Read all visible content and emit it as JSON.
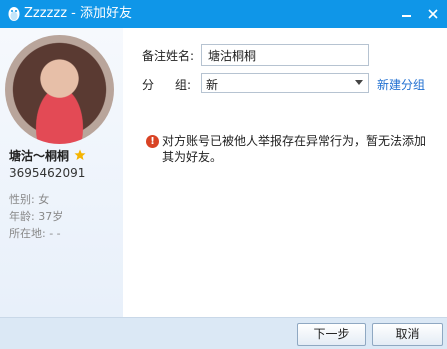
{
  "window": {
    "title": "Zzzzzz - 添加好友"
  },
  "profile": {
    "nickname": "塘沽～桐桐",
    "qq": "3695462091",
    "gender": "性别: 女",
    "age": "年龄: 37岁",
    "location": "所在地:  -    -"
  },
  "form": {
    "remark_label": "备注姓名:",
    "remark_value": "塘沽桐桐",
    "group_label_1": "分",
    "group_label_2": "组:",
    "group_value": "新",
    "new_group_link": "新建分组"
  },
  "warning": {
    "text": "对方账号已被他人举报存在异常行为，暂无法添加其为好友。"
  },
  "buttons": {
    "next": "下一步",
    "cancel": "取消"
  },
  "colors": {
    "titlebar": "#0f96e8",
    "link": "#1f6fd1",
    "warning_icon": "#d94324"
  }
}
